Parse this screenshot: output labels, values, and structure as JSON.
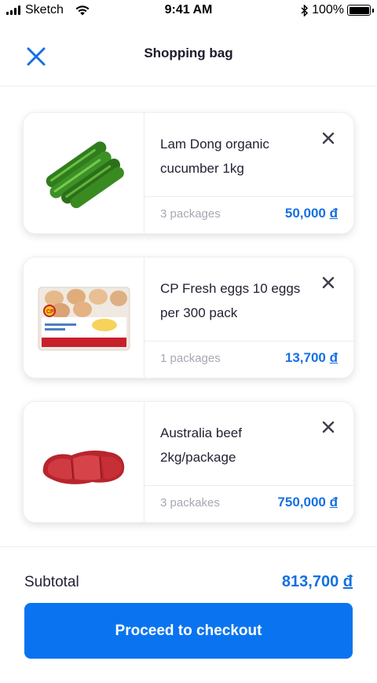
{
  "status_bar": {
    "carrier": "Sketch",
    "time": "9:41 AM",
    "battery": "100%"
  },
  "header": {
    "title": "Shopping bag"
  },
  "items": [
    {
      "name": "Lam Dong organic cucumber 1kg",
      "quantity": "3 packages",
      "price": "50,000",
      "currency": "đ",
      "image": "cucumber"
    },
    {
      "name": "CP Fresh eggs 10 eggs per 300 pack",
      "quantity": "1 packages",
      "price": "13,700",
      "currency": "đ",
      "image": "egg-carton"
    },
    {
      "name": "Australia beef 2kg/package",
      "quantity": "3 packakes",
      "price": "750,000",
      "currency": "đ",
      "image": "beef"
    }
  ],
  "summary": {
    "subtotal_label": "Subtotal",
    "subtotal_value": "813,700",
    "currency": "đ"
  },
  "checkout": {
    "label": "Proceed to checkout"
  },
  "colors": {
    "accent": "#1570e0",
    "button": "#0a74f0",
    "close_icon": "#1570e0",
    "muted": "#a7a7b3"
  }
}
